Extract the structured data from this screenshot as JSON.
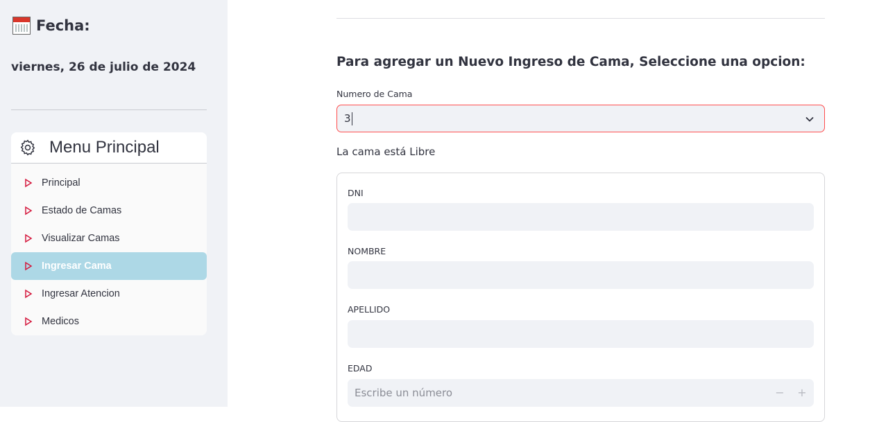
{
  "sidebar": {
    "date_title": "Fecha:",
    "date_value": "viernes, 26 de julio de 2024",
    "menu": {
      "title": "Menu Principal",
      "items": [
        {
          "label": "Principal",
          "active": false
        },
        {
          "label": "Estado de Camas",
          "active": false
        },
        {
          "label": "Visualizar Camas",
          "active": false
        },
        {
          "label": "Ingresar Cama",
          "active": true
        },
        {
          "label": "Ingresar Atencion",
          "active": false
        },
        {
          "label": "Medicos",
          "active": false
        }
      ]
    }
  },
  "main": {
    "heading": "Para agregar un Nuevo Ingreso de Cama, Seleccione una opcion:",
    "bed_select": {
      "label": "Numero de Cama",
      "value": "3"
    },
    "status_text": "La cama está Libre",
    "form": {
      "dni_label": "DNI",
      "dni_value": "",
      "nombre_label": "NOMBRE",
      "nombre_value": "",
      "apellido_label": "APELLIDO",
      "apellido_value": "",
      "edad_label": "EDAD",
      "edad_placeholder": "Escribe un número",
      "minus": "−",
      "plus": "+"
    }
  },
  "colors": {
    "sidebar_bg": "#f0f2f6",
    "active_item_bg": "#add8e6",
    "triangle_icon": "#d4183d",
    "select_focus_border": "#ff4b4b"
  }
}
